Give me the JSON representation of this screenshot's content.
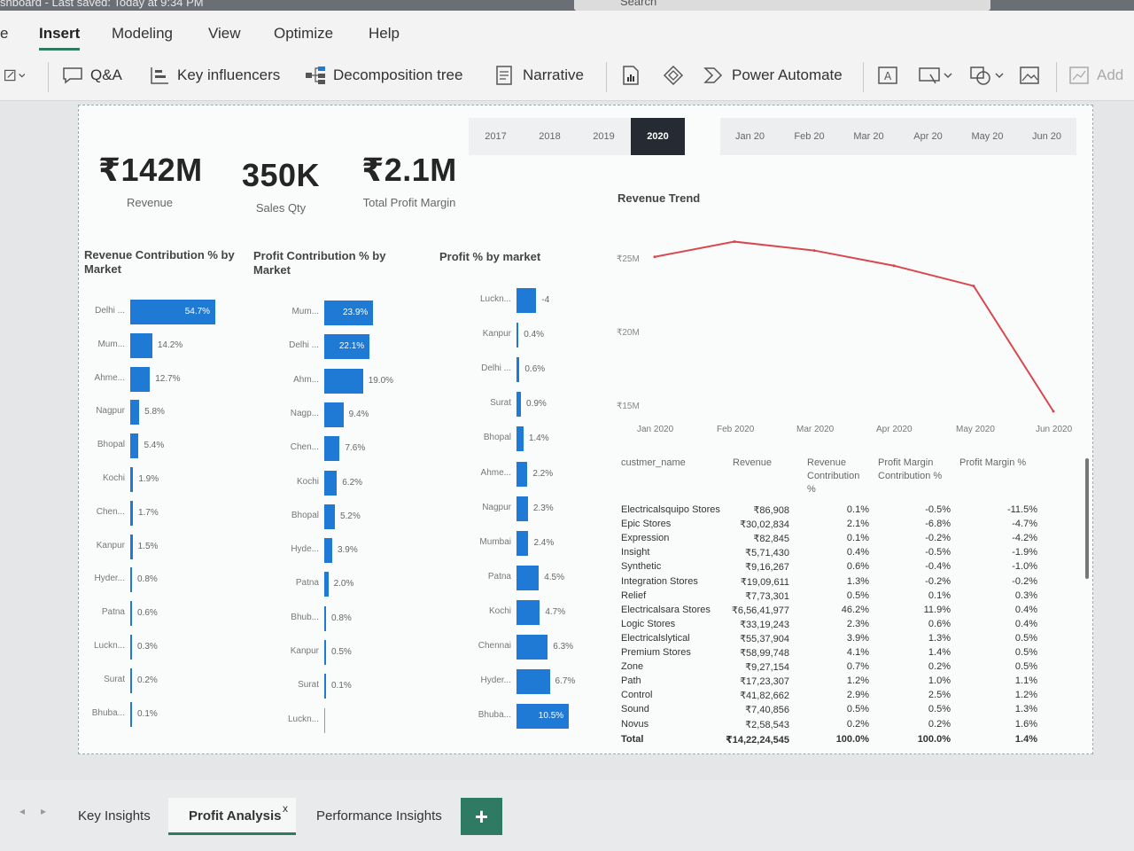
{
  "title_bar": {
    "text": "shboard - Last saved: Today at 9:34 PM",
    "search_placeholder": "Search"
  },
  "menu": {
    "tabs": [
      "e",
      "Insert",
      "Modeling",
      "View",
      "Optimize",
      "Help"
    ],
    "active": "Insert"
  },
  "ribbon": {
    "qa": "Q&A",
    "key_influencers": "Key influencers",
    "decomposition_tree": "Decomposition tree",
    "narrative": "Narrative",
    "power_automate": "Power Automate",
    "add": "Add"
  },
  "slicers": {
    "years": [
      "2017",
      "2018",
      "2019",
      "2020"
    ],
    "selected_year": "2020",
    "months": [
      "Jan 20",
      "Feb 20",
      "Mar 20",
      "Apr 20",
      "May 20",
      "Jun 20"
    ]
  },
  "kpis": [
    {
      "value": "₹142M",
      "label": "Revenue"
    },
    {
      "value": "350K",
      "label": "Sales Qty"
    },
    {
      "value": "₹2.1M",
      "label": "Total Profit Margin"
    }
  ],
  "revenue_contribution": {
    "title": "Revenue Contribution % by Market",
    "categories": [
      "Delhi ...",
      "Mum...",
      "Ahme...",
      "Nagpur",
      "Bhopal",
      "Kochi",
      "Chen...",
      "Kanpur",
      "Hyder...",
      "Patna",
      "Luckn...",
      "Surat",
      "Bhuba..."
    ],
    "values": [
      54.7,
      14.2,
      12.7,
      5.8,
      5.4,
      1.9,
      1.7,
      1.5,
      0.8,
      0.6,
      0.3,
      0.2,
      0.1
    ],
    "labels": [
      "54.7%",
      "14.2%",
      "12.7%",
      "5.8%",
      "5.4%",
      "1.9%",
      "1.7%",
      "1.5%",
      "0.8%",
      "0.6%",
      "0.3%",
      "0.2%",
      "0.1%"
    ]
  },
  "profit_contribution": {
    "title": "Profit Contribution % by Market",
    "categories": [
      "Mum...",
      "Delhi ...",
      "Ahm...",
      "Nagp...",
      "Chen...",
      "Kochi",
      "Bhopal",
      "Hyde...",
      "Patna",
      "Bhub...",
      "Kanpur",
      "Surat",
      "Luckn..."
    ],
    "values": [
      23.9,
      22.1,
      19.0,
      9.4,
      7.6,
      6.2,
      5.2,
      3.9,
      2.0,
      0.8,
      0.5,
      0.1,
      0
    ],
    "labels": [
      "23.9%",
      "22.1%",
      "19.0%",
      "9.4%",
      "7.6%",
      "6.2%",
      "5.2%",
      "3.9%",
      "2.0%",
      "0.8%",
      "0.5%",
      "0.1%",
      ""
    ]
  },
  "profit_pct_market": {
    "title": "Profit % by market",
    "categories": [
      "Luckn...",
      "Kanpur",
      "Delhi ...",
      "Surat",
      "Bhopal",
      "Ahme...",
      "Nagpur",
      "Mumbai",
      "Patna",
      "Kochi",
      "Chennai",
      "Hyder...",
      "Bhuba..."
    ],
    "values": [
      -4,
      0.4,
      0.6,
      0.9,
      1.4,
      2.2,
      2.3,
      2.4,
      4.5,
      4.7,
      6.3,
      6.7,
      10.5
    ],
    "labels": [
      "-4",
      "0.4%",
      "0.6%",
      "0.9%",
      "1.4%",
      "2.2%",
      "2.3%",
      "2.4%",
      "4.5%",
      "4.7%",
      "6.3%",
      "6.7%",
      "10.5%"
    ]
  },
  "chart_data": {
    "type": "line",
    "title": "Revenue Trend",
    "x": [
      "Jan 2020",
      "Feb 2020",
      "Mar 2020",
      "Apr 2020",
      "May 2020",
      "Jun 2020"
    ],
    "series": [
      {
        "values": [
          26.2,
          27.4,
          26.7,
          25.5,
          23.9,
          14.0
        ],
        "color": "#d9474f"
      }
    ],
    "y_ticks": [
      "₹25M",
      "₹20M",
      "₹15M"
    ],
    "ylim": [
      14,
      28
    ]
  },
  "table": {
    "headers": [
      "custmer_name",
      "Revenue",
      "Revenue Contribution %",
      "Profit Margin Contribution %",
      "Profit Margin %"
    ],
    "rows": [
      [
        "Electricalsquipo Stores",
        "₹86,908",
        "0.1%",
        "-0.5%",
        "-11.5%"
      ],
      [
        "Epic Stores",
        "₹30,02,834",
        "2.1%",
        "-6.8%",
        "-4.7%"
      ],
      [
        "Expression",
        "₹82,845",
        "0.1%",
        "-0.2%",
        "-4.2%"
      ],
      [
        "Insight",
        "₹5,71,430",
        "0.4%",
        "-0.5%",
        "-1.9%"
      ],
      [
        "Synthetic",
        "₹9,16,267",
        "0.6%",
        "-0.4%",
        "-1.0%"
      ],
      [
        "Integration Stores",
        "₹19,09,611",
        "1.3%",
        "-0.2%",
        "-0.2%"
      ],
      [
        "Relief",
        "₹7,73,301",
        "0.5%",
        "0.1%",
        "0.3%"
      ],
      [
        "Electricalsara Stores",
        "₹6,56,41,977",
        "46.2%",
        "11.9%",
        "0.4%"
      ],
      [
        "Logic Stores",
        "₹33,19,243",
        "2.3%",
        "0.6%",
        "0.4%"
      ],
      [
        "Electricalslytical",
        "₹55,37,904",
        "3.9%",
        "1.3%",
        "0.5%"
      ],
      [
        "Premium Stores",
        "₹58,99,748",
        "4.1%",
        "1.4%",
        "0.5%"
      ],
      [
        "Zone",
        "₹9,27,154",
        "0.7%",
        "0.2%",
        "0.5%"
      ],
      [
        "Path",
        "₹17,23,307",
        "1.2%",
        "1.0%",
        "1.1%"
      ],
      [
        "Control",
        "₹41,82,662",
        "2.9%",
        "2.5%",
        "1.2%"
      ],
      [
        "Sound",
        "₹7,40,856",
        "0.5%",
        "0.5%",
        "1.3%"
      ],
      [
        "Novus",
        "₹2,58,543",
        "0.2%",
        "0.2%",
        "1.6%"
      ]
    ],
    "total": [
      "Total",
      "₹14,22,24,545",
      "100.0%",
      "100.0%",
      "1.4%"
    ]
  },
  "pages": {
    "tabs": [
      "Key Insights",
      "Profit Analysis",
      "Performance Insights"
    ],
    "active": "Profit Analysis",
    "close": "x",
    "add": "+"
  }
}
